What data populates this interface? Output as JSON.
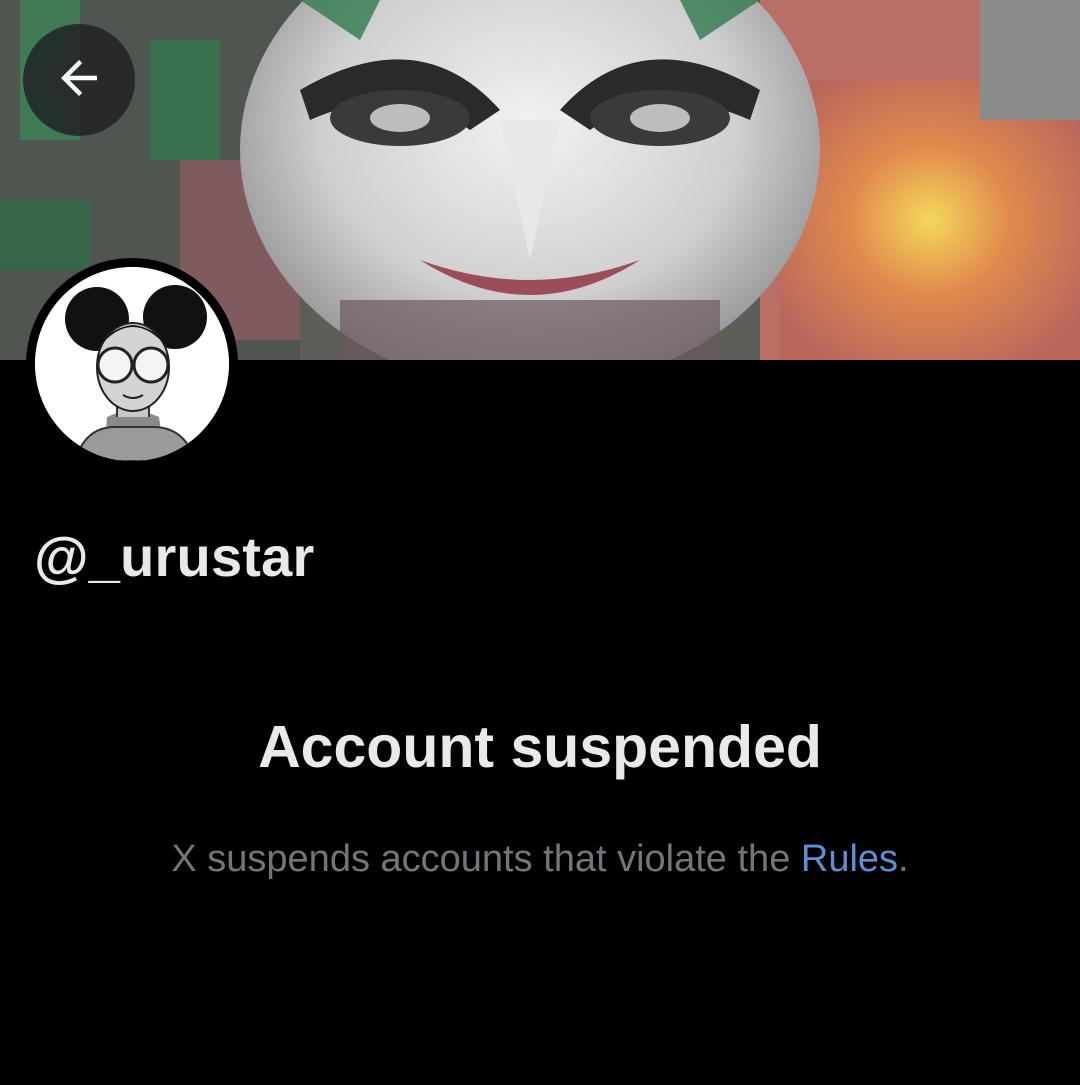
{
  "header": {
    "back_icon": "arrow-left-icon"
  },
  "profile": {
    "handle": "@_urustar"
  },
  "suspension": {
    "title": "Account suspended",
    "message_prefix": "X suspends accounts that violate the ",
    "rules_link": "Rules",
    "message_suffix": "."
  },
  "colors": {
    "background": "#000000",
    "primary_text": "#e7e9ea",
    "secondary_text": "#71767b",
    "link": "#5b8fd6"
  }
}
